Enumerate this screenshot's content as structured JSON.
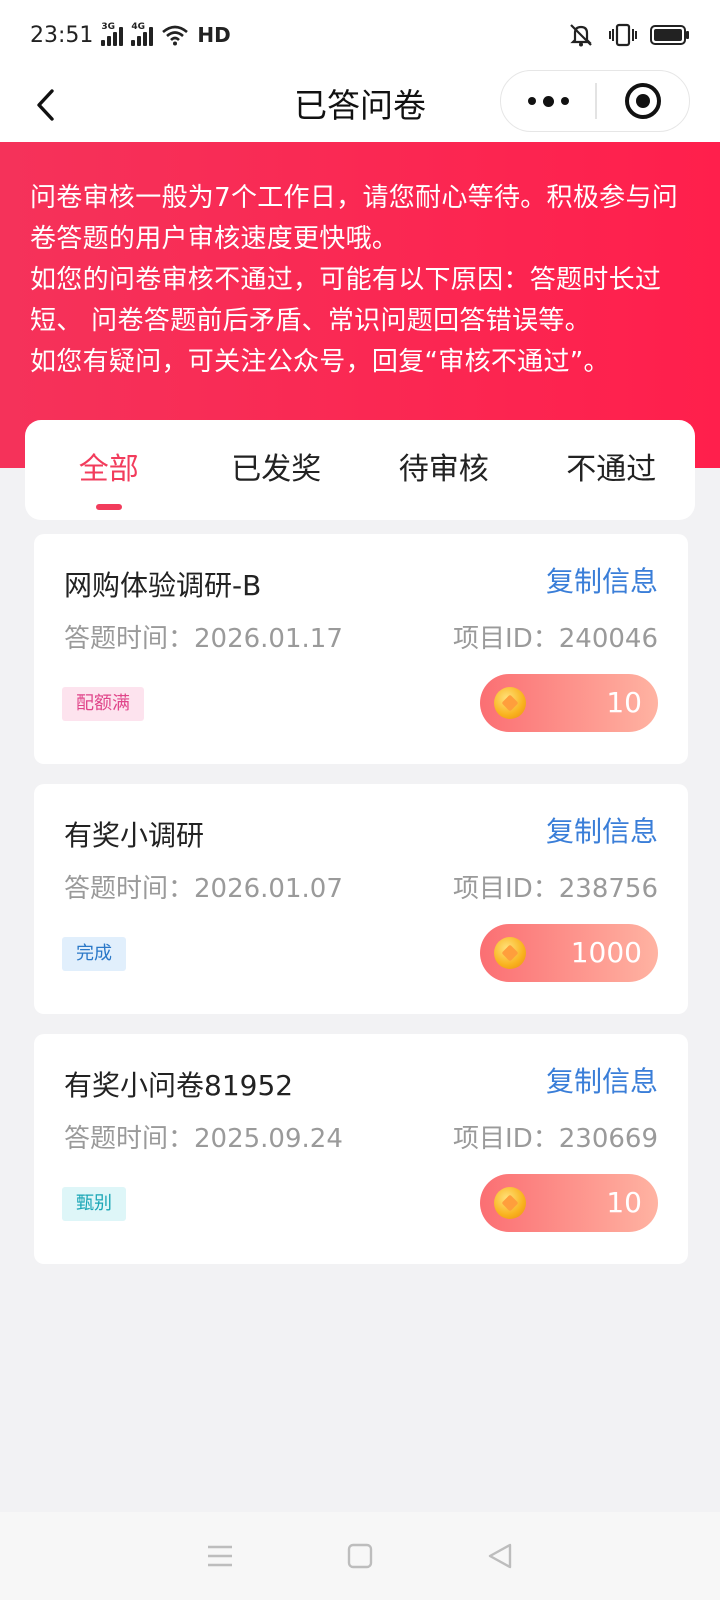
{
  "status_bar": {
    "time": "23:51",
    "signal1_tag": "3G",
    "signal2_tag": "4G",
    "hd_label": "HD"
  },
  "nav": {
    "title": "已答问卷"
  },
  "banner": {
    "lines": [
      "问卷审核一般为7个工作日，请您耐心等待。积极参与问卷答题的用户审核速度更快哦。",
      "如您的问卷审核不通过，可能有以下原因：答题时长过短、 问卷答题前后矛盾、常识问题回答错误等。",
      "如您有疑问，可关注公众号，回复“审核不通过”。"
    ]
  },
  "tabs": [
    {
      "label": "全部",
      "active": true
    },
    {
      "label": "已发奖",
      "active": false
    },
    {
      "label": "待审核",
      "active": false
    },
    {
      "label": "不通过",
      "active": false
    }
  ],
  "cards": [
    {
      "title": "网购体验调研-B",
      "copy_label": "复制信息",
      "time": "答题时间：2026.01.17",
      "project_id": "项目ID：240046",
      "badge": "配额满",
      "badge_color": "#e0458a",
      "badge_bg": "#fde3ee",
      "reward": "10"
    },
    {
      "title": "有奖小调研",
      "copy_label": "复制信息",
      "time": "答题时间：2026.01.07",
      "project_id": "项目ID：238756",
      "badge": "完成",
      "badge_color": "#2a78c8",
      "badge_bg": "#e1effc",
      "reward": "1000"
    },
    {
      "title": "有奖小问卷81952",
      "copy_label": "复制信息",
      "time": "答题时间：2025.09.24",
      "project_id": "项目ID：230669",
      "badge": "甄别",
      "badge_color": "#1aa6b6",
      "badge_bg": "#def6f8",
      "reward": "10"
    }
  ],
  "colors": {
    "accent": "#f23c5c",
    "banner": "#ff1f4c",
    "link": "#3a7ed8"
  },
  "icons": {
    "back": "chevron-left-icon",
    "more": "more-dots-icon",
    "close": "target-circle-icon",
    "coin": "coin-icon"
  }
}
